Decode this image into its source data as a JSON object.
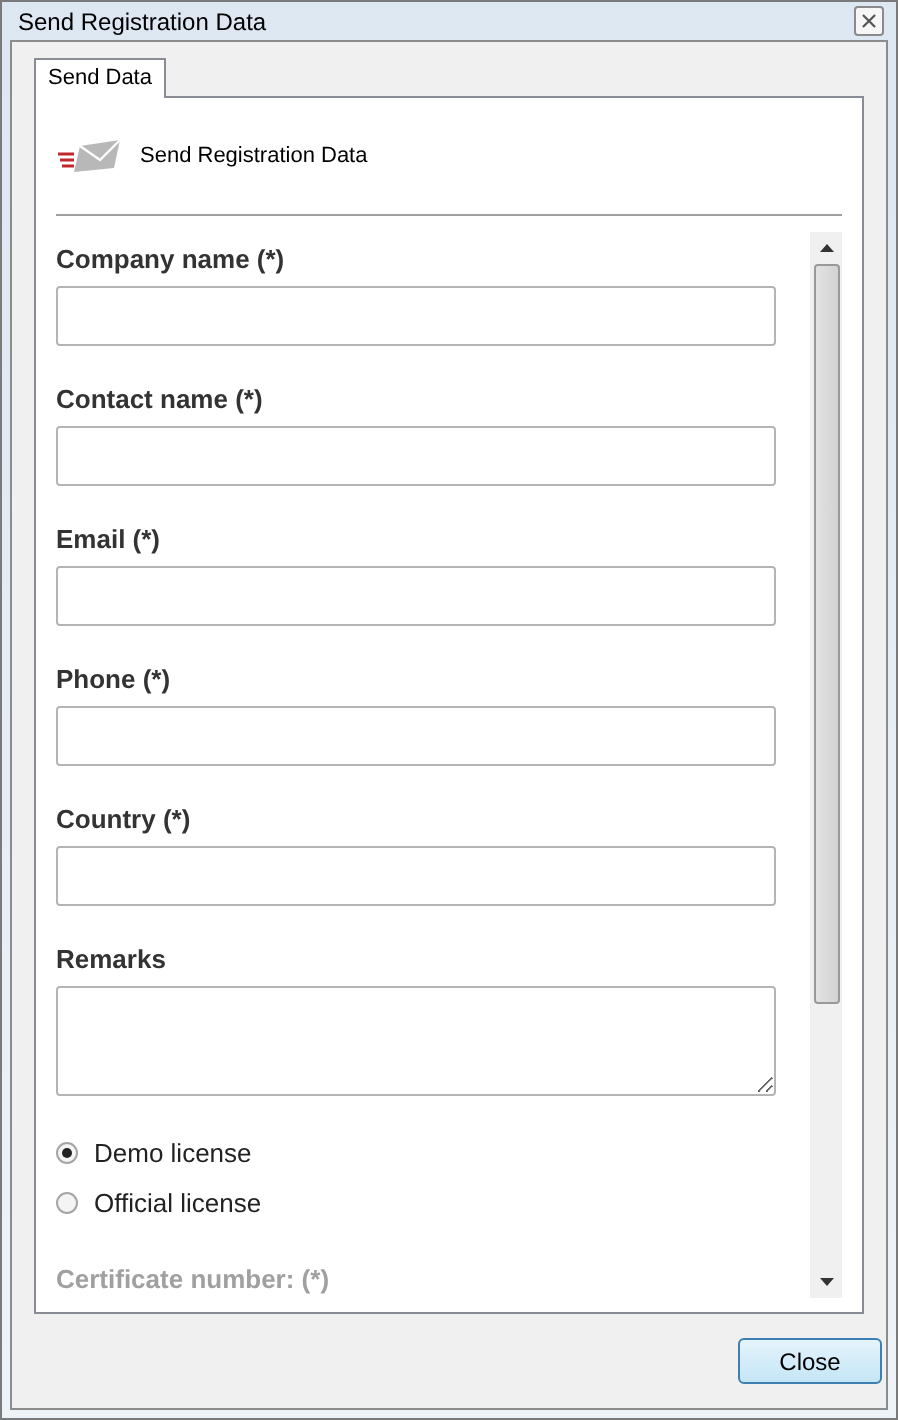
{
  "window": {
    "title": "Send Registration Data"
  },
  "tabs": [
    {
      "label": "Send Data",
      "selected": true
    }
  ],
  "header": {
    "title": "Send Registration Data"
  },
  "fields": [
    {
      "label": "Company name (*)",
      "kind": "line",
      "disabled": false
    },
    {
      "label": "Contact name (*)",
      "kind": "line",
      "disabled": false
    },
    {
      "label": "Email (*)",
      "kind": "line",
      "disabled": false
    },
    {
      "label": "Phone (*)",
      "kind": "line",
      "disabled": false
    },
    {
      "label": "Country (*)",
      "kind": "line",
      "disabled": false
    },
    {
      "label": "Remarks",
      "kind": "multiline",
      "disabled": false
    }
  ],
  "license": [
    {
      "label": "Demo license",
      "selected": true
    },
    {
      "label": "Official license",
      "selected": false
    }
  ],
  "certificate": {
    "label": "Certificate number: (*)",
    "disabled": true
  },
  "buttons": [
    {
      "label": "Close"
    }
  ]
}
